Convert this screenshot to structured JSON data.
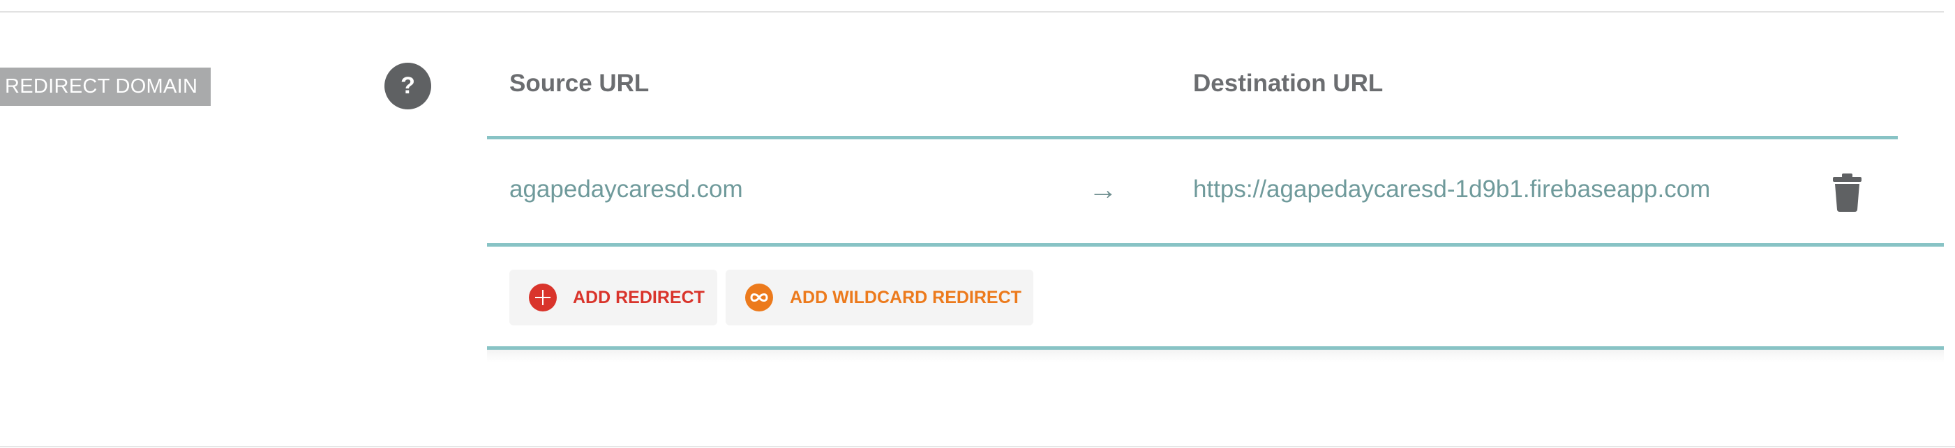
{
  "section": {
    "label": "REDIRECT DOMAIN",
    "help": "?"
  },
  "table": {
    "headers": {
      "source": "Source URL",
      "destination": "Destination URL"
    },
    "rows": [
      {
        "source": "agapedaycaresd.com",
        "arrow": "→",
        "destination": "https://agapedaycaresd-1d9b1.firebaseapp.com"
      }
    ]
  },
  "actions": {
    "add_redirect": "ADD REDIRECT",
    "add_wildcard_redirect": "ADD WILDCARD REDIRECT"
  },
  "colors": {
    "accent_teal": "#88c3c5",
    "add_red": "#d9342b",
    "wildcard_orange": "#ec7a1c",
    "label_bg": "#a9aaab",
    "help_bg": "#5f6163"
  },
  "icons": {
    "help": "question-mark-icon",
    "delete": "trash-icon",
    "add": "plus-circle-icon",
    "wildcard": "infinity-circle-icon"
  }
}
